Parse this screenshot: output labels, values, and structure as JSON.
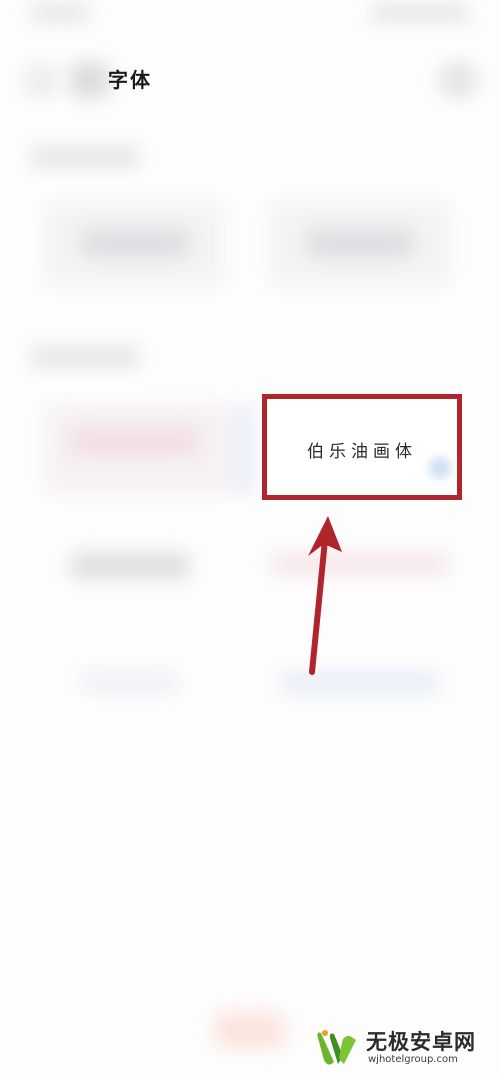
{
  "header": {
    "title": "字体"
  },
  "highlight": {
    "font_name": "伯乐油画体",
    "border_color": "#b0252c",
    "arrow_color": "#b0252c"
  },
  "watermark": {
    "name": "无极安卓网",
    "url": "wjhotelgroup.com"
  }
}
